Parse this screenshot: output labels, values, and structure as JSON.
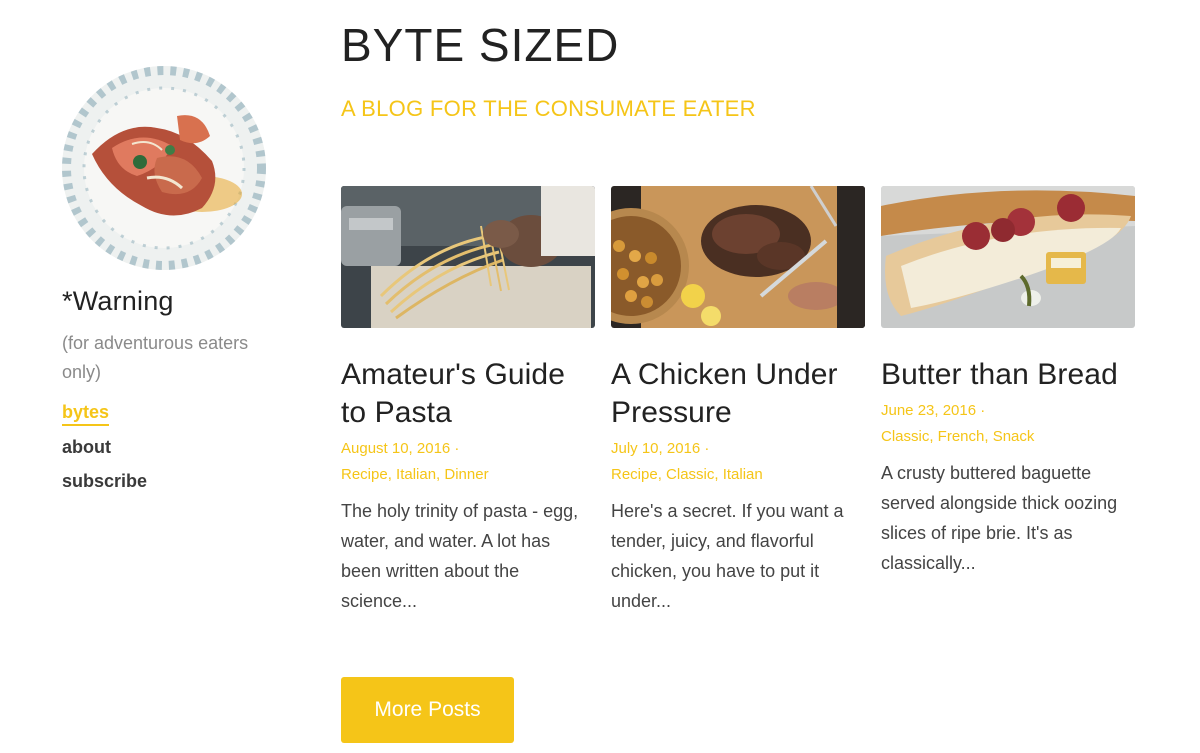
{
  "sidebar": {
    "warning_title": "*Warning",
    "warning_subtitle": "(for adventurous eaters only)",
    "nav": [
      {
        "label": "bytes",
        "active": true
      },
      {
        "label": "about",
        "active": false
      },
      {
        "label": "subscribe",
        "active": false
      }
    ]
  },
  "header": {
    "title": "BYTE SIZED",
    "tagline": "A BLOG FOR THE CONSUMATE EATER"
  },
  "posts": [
    {
      "title": "Amateur's Guide to Pasta",
      "date": "August 10, 2016 ·",
      "tags": "Recipe, Italian, Dinner",
      "excerpt": "The holy trinity of pasta - egg, water, and water. A lot has been written about the science..."
    },
    {
      "title": "A Chicken Under Pressure",
      "date": "July 10, 2016 ·",
      "tags": "Recipe, Classic, Italian",
      "excerpt": "Here's a secret. If you want a tender, juicy, and flavorful chicken, you have to put it under..."
    },
    {
      "title": "Butter than Bread",
      "date": "June 23, 2016 ·",
      "tags": "Classic, French, Snack",
      "excerpt": "A crusty buttered baguette served alongside thick oozing slices of ripe brie. It's as classically..."
    }
  ],
  "more_button": "More Posts",
  "colors": {
    "accent": "#f5c518",
    "text": "#222222",
    "muted": "#8a8a8a"
  }
}
